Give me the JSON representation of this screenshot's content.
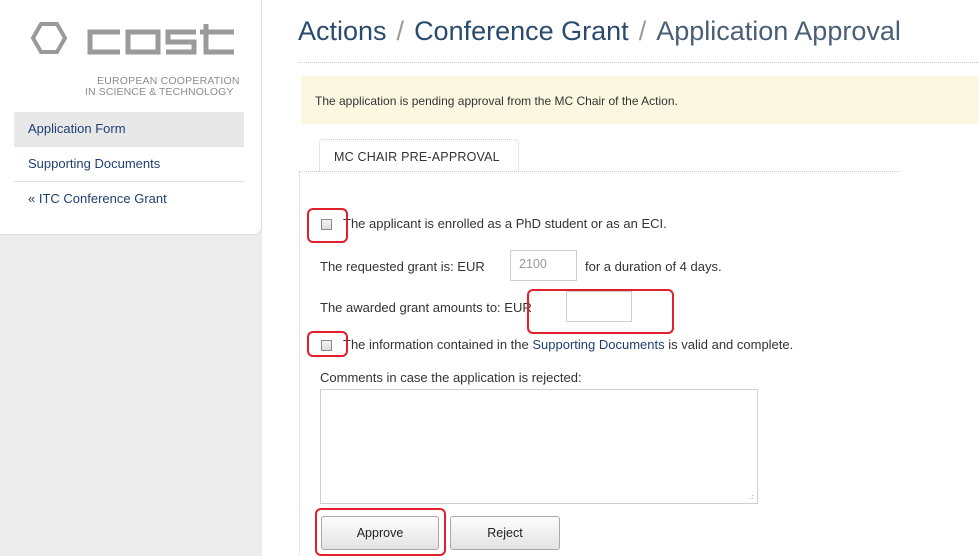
{
  "logo": {
    "wordmark": "cost",
    "line1": "EUROPEAN COOPERATION",
    "line2": "IN SCIENCE & TECHNOLOGY"
  },
  "sidebar": {
    "items": [
      {
        "label": "Application Form"
      },
      {
        "label": "Supporting Documents"
      },
      {
        "label": "« ITC Conference Grant"
      }
    ]
  },
  "breadcrumb": {
    "items": [
      "Actions",
      "Conference Grant",
      "Application Approval"
    ],
    "separator": "/"
  },
  "notice": {
    "text": "The application is pending approval from the MC Chair of the Action."
  },
  "tab": {
    "label": "MC CHAIR PRE-APPROVAL"
  },
  "form": {
    "phd_checkbox_label": "The applicant is enrolled as a PhD student or as an ECI.",
    "requested_prefix": "The requested grant is: EUR",
    "requested_value": "2100",
    "requested_suffix": "for a duration of 4 days.",
    "awarded_prefix": "The awarded grant amounts to: EUR",
    "awarded_value": "",
    "info_prefix": "The information contained in the",
    "info_link": "Supporting Documents",
    "info_suffix": "is valid and complete.",
    "comments_label": "Comments in case the application is rejected:",
    "comments_value": "",
    "approve_label": "Approve",
    "reject_label": "Reject"
  },
  "colors": {
    "title": "#2b4a6f",
    "link": "#1f3f72",
    "notice_bg": "#fcf7e1",
    "highlight": "#e0202a"
  }
}
